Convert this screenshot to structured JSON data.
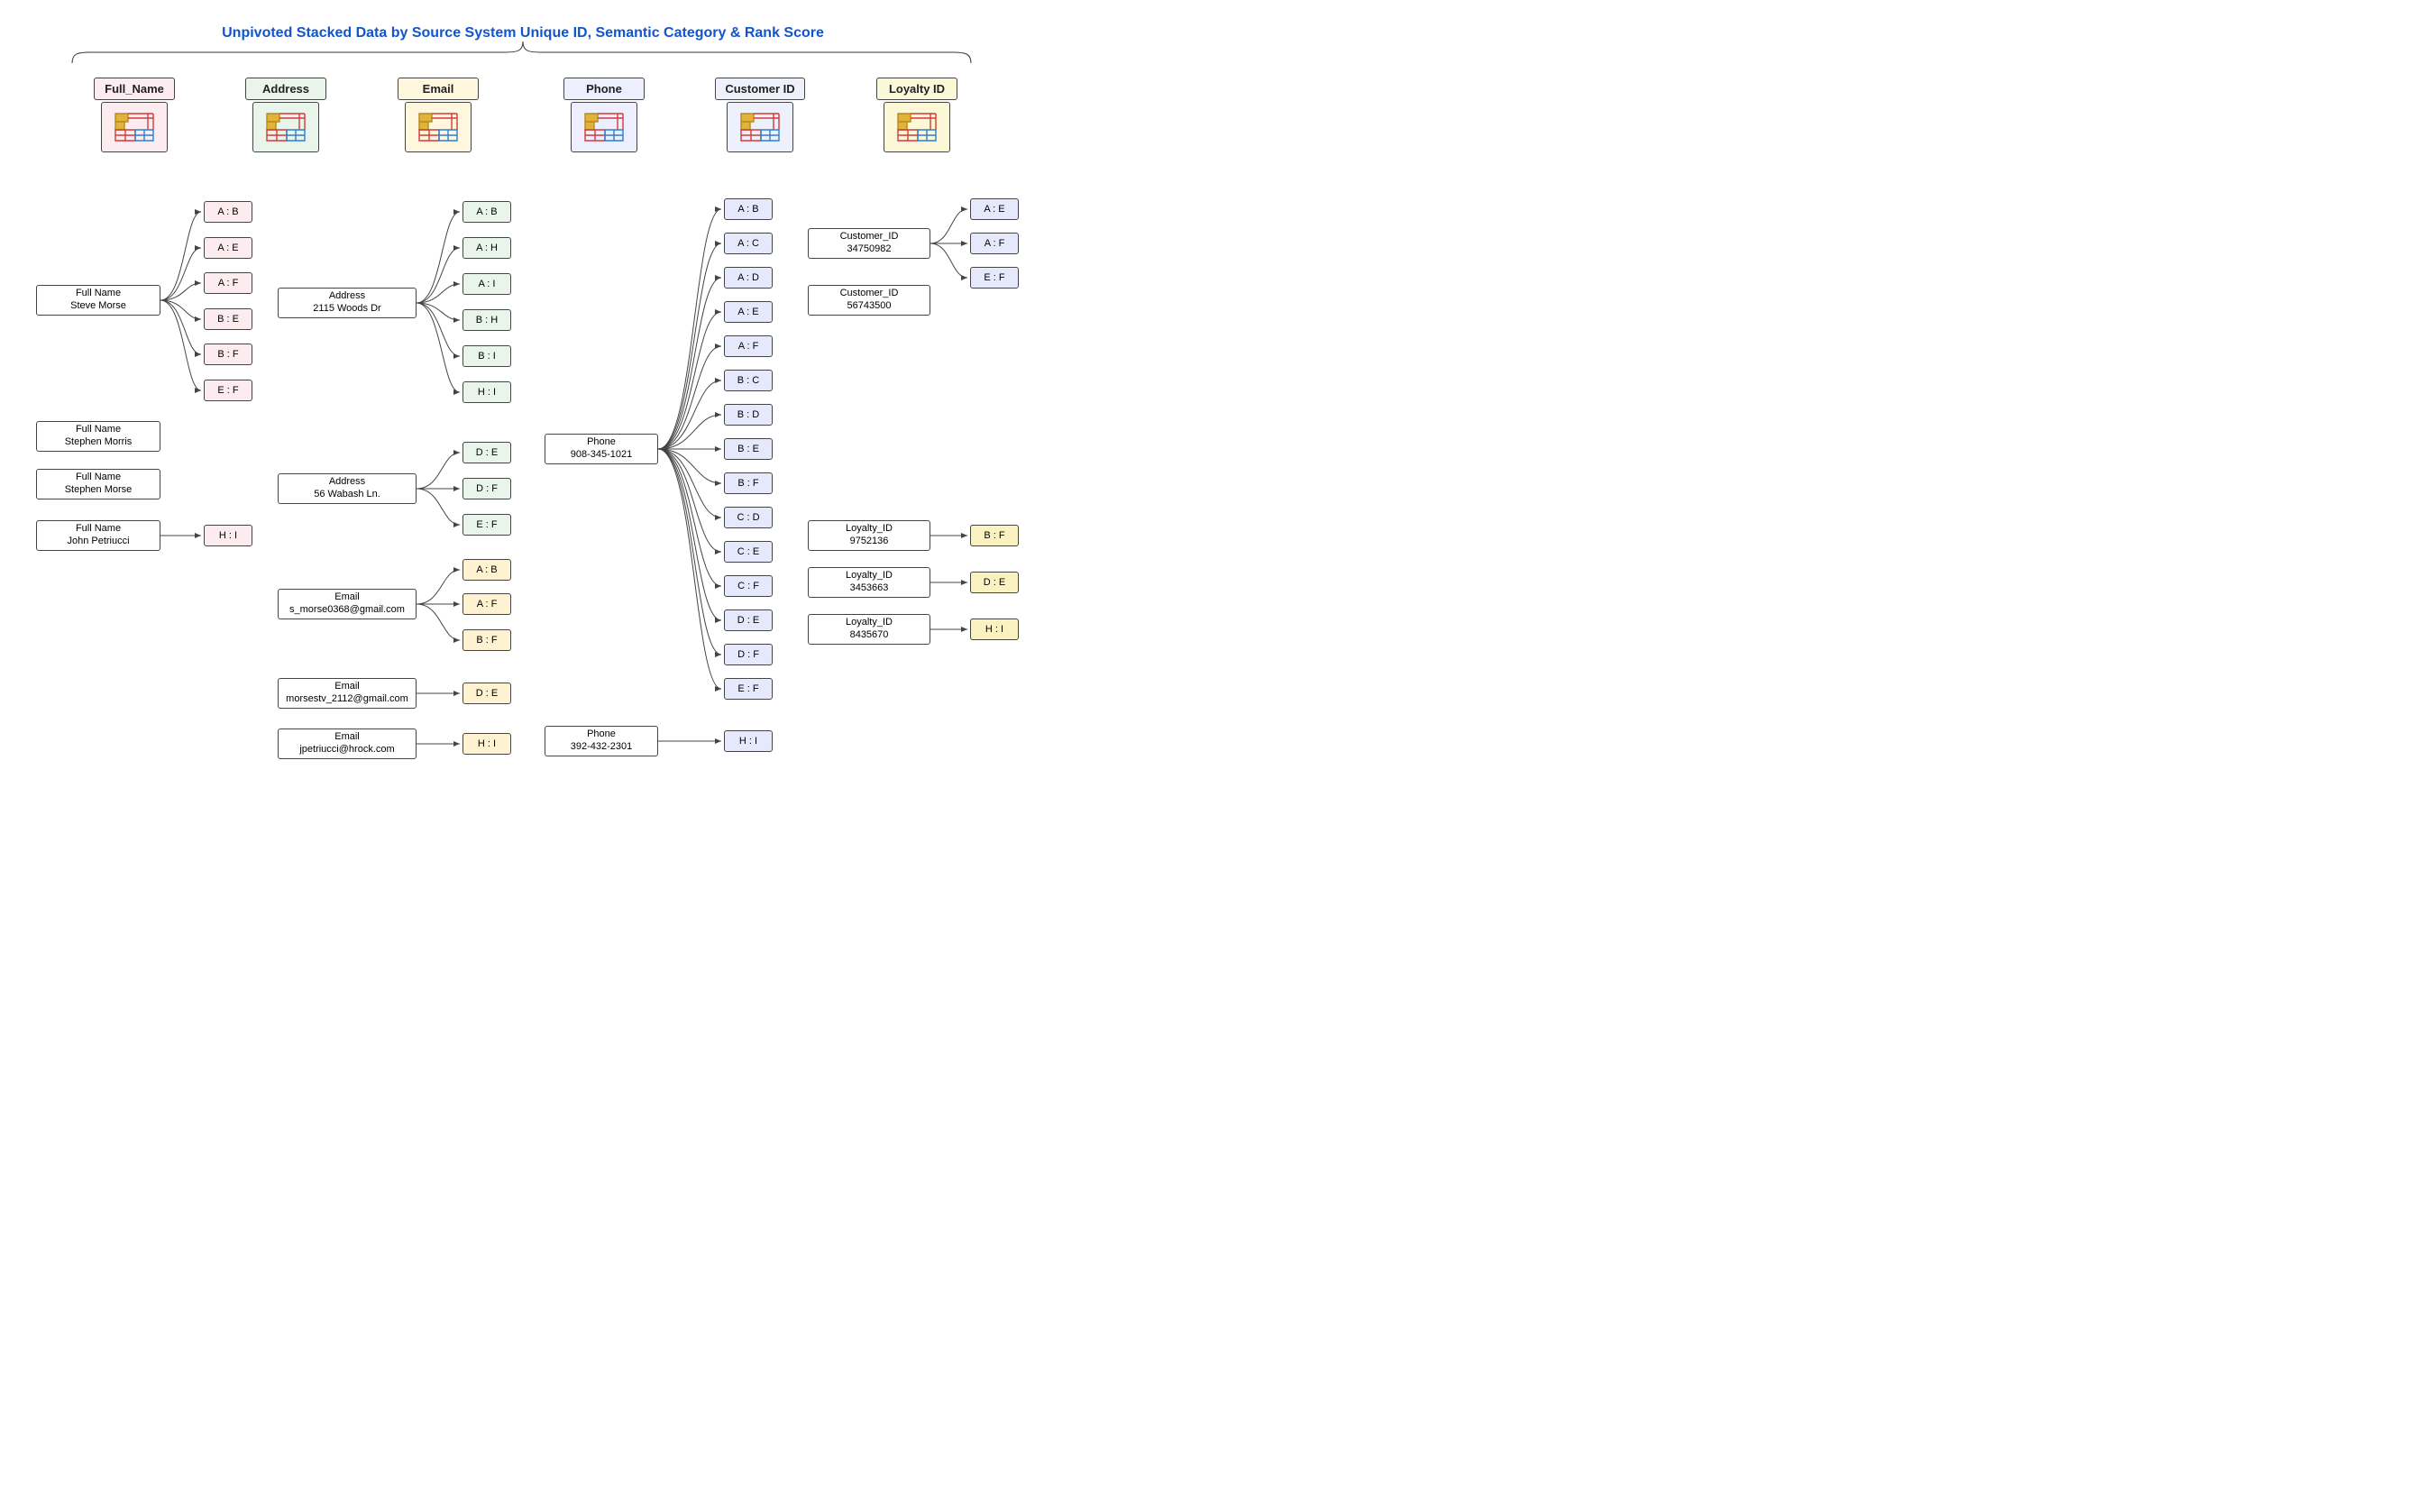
{
  "title": "Unpivoted Stacked Data by Source System Unique ID,  Semantic Category & Rank Score",
  "headers": {
    "full_name": "Full_Name",
    "address": "Address",
    "email": "Email",
    "phone": "Phone",
    "customer_id": "Customer ID",
    "loyalty_id": "Loyalty ID"
  },
  "tints": {
    "full_name": "#fdecef",
    "address": "#e9f5ea",
    "email": "#fff6de",
    "phone": "#edefff",
    "customer_id": "#eef1fb",
    "loyalty_id": "#fbf7d7"
  },
  "pair_tints": {
    "full_name": "#fdecef",
    "address": "#e9f5ea",
    "email": "#fff2d0",
    "phone": "#e6e9fb",
    "customer_id": "#e6e9fb",
    "loyalty_id": "#fbf2c2"
  },
  "nodes": {
    "fn1": {
      "l1": "Full Name",
      "l2": "Steve Morse"
    },
    "fn2": {
      "l1": "Full Name",
      "l2": "Stephen Morris"
    },
    "fn3": {
      "l1": "Full Name",
      "l2": "Stephen Morse"
    },
    "fn4": {
      "l1": "Full Name",
      "l2": "John Petriucci"
    },
    "ad1": {
      "l1": "Address",
      "l2": "2115 Woods Dr"
    },
    "ad2": {
      "l1": "Address",
      "l2": "56 Wabash Ln."
    },
    "em1": {
      "l1": "Email",
      "l2": "s_morse0368@gmail.com"
    },
    "em2": {
      "l1": "Email",
      "l2": "morsestv_2112@gmail.com"
    },
    "em3": {
      "l1": "Email",
      "l2": "jpetriucci@hrock.com"
    },
    "ph1": {
      "l1": "Phone",
      "l2": "908-345-1021"
    },
    "ph2": {
      "l1": "Phone",
      "l2": "392-432-2301"
    },
    "cu1": {
      "l1": "Customer_ID",
      "l2": "34750982"
    },
    "cu2": {
      "l1": "Customer_ID",
      "l2": "56743500"
    },
    "lo1": {
      "l1": "Loyalty_ID",
      "l2": "9752136"
    },
    "lo2": {
      "l1": "Loyalty_ID",
      "l2": "3453663"
    },
    "lo3": {
      "l1": "Loyalty_ID",
      "l2": "8435670"
    }
  },
  "pairs": {
    "fn_ab": "A : B",
    "fn_ae": "A : E",
    "fn_af": "A : F",
    "fn_be": "B : E",
    "fn_bf": "B : F",
    "fn_ef": "E : F",
    "fn_hi": "H : I",
    "ad_ab": "A : B",
    "ad_ah": "A : H",
    "ad_ai": "A : I",
    "ad_bh": "B : H",
    "ad_bi": "B : I",
    "ad_hi": "H : I",
    "ad2_de": "D : E",
    "ad2_df": "D : F",
    "ad2_ef": "E : F",
    "em_ab": "A : B",
    "em_af": "A : F",
    "em_bf": "B : F",
    "em2_de": "D : E",
    "em3_hi": "H : I",
    "ph_ab": "A : B",
    "ph_ac": "A : C",
    "ph_ad": "A : D",
    "ph_ae": "A : E",
    "ph_af": "A : F",
    "ph_bc": "B : C",
    "ph_bd": "B : D",
    "ph_be": "B : E",
    "ph_bf": "B : F",
    "ph_cd": "C : D",
    "ph_ce": "C : E",
    "ph_cf": "C : F",
    "ph_de": "D : E",
    "ph_df": "D : F",
    "ph_ef": "E : F",
    "ph2_hi": "H : I",
    "cu_ae": "A : E",
    "cu_af": "A : F",
    "cu_ef": "E : F",
    "lo1_bf": "B : F",
    "lo2_de": "D : E",
    "lo3_hi": "H : I"
  }
}
